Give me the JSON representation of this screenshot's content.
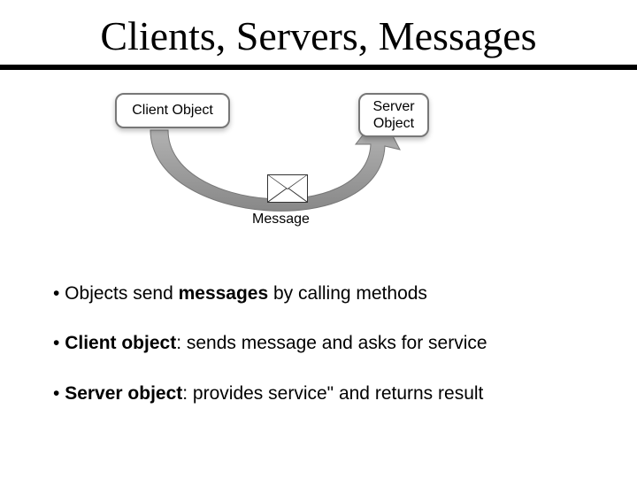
{
  "title": "Clients, Servers, Messages",
  "diagram": {
    "client_label": "Client Object",
    "server_label_line1": "Server",
    "server_label_line2": "Object",
    "message_label": "Message"
  },
  "bullets": {
    "b1_prefix": "• Objects send ",
    "b1_bold": "messages",
    "b1_suffix": " by calling methods",
    "b2_prefix": "• ",
    "b2_bold": "Client object",
    "b2_suffix": ": sends message and asks for service",
    "b3_prefix": "• ",
    "b3_bold": "Server object",
    "b3_suffix": ": provides service\" and returns result"
  }
}
